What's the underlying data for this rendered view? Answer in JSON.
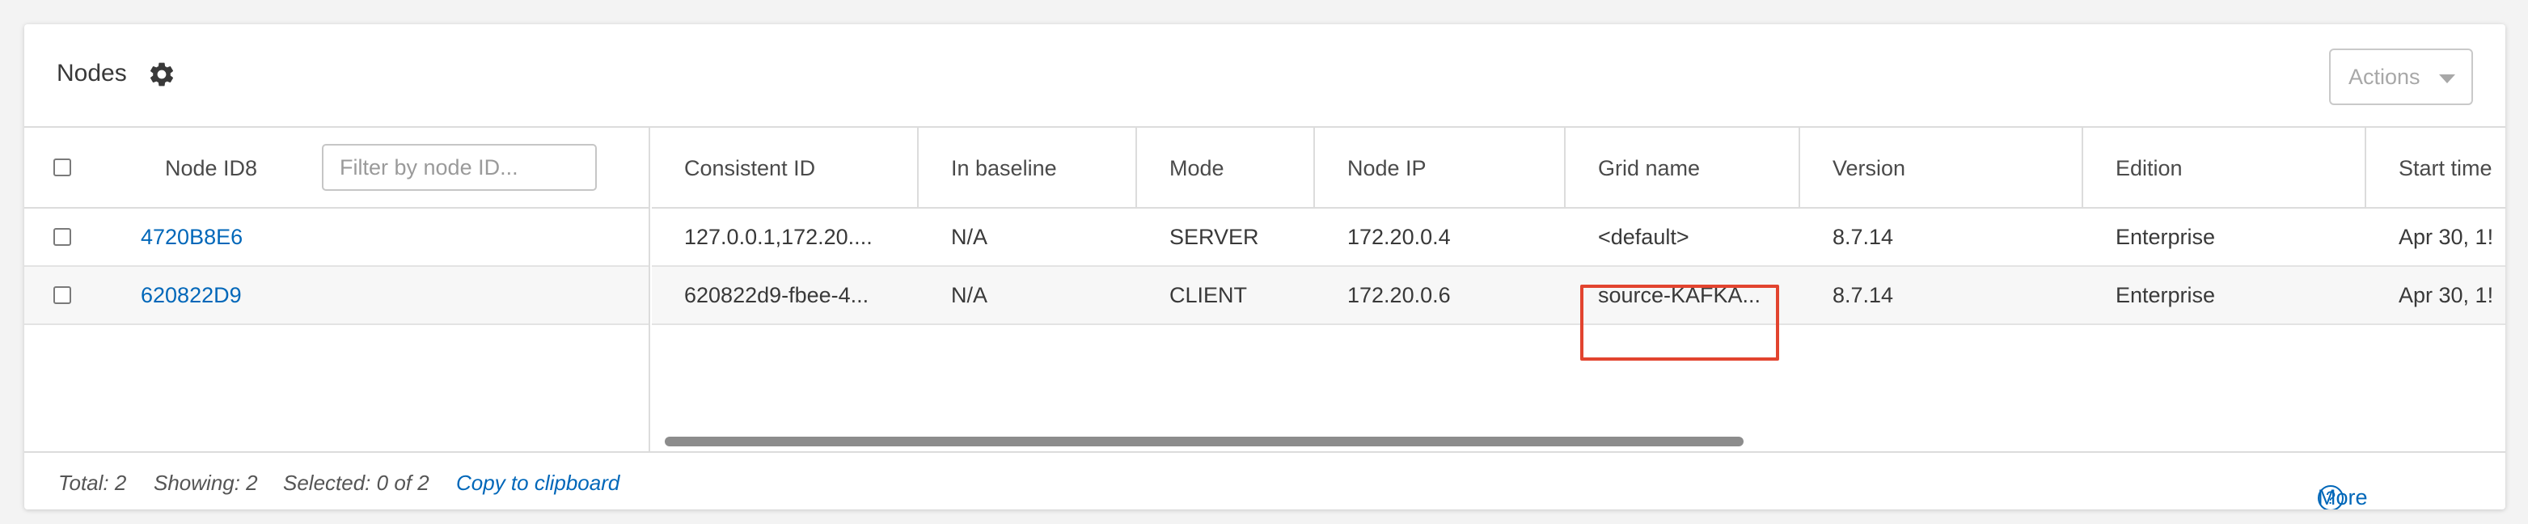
{
  "header": {
    "title": "Nodes",
    "actions_label": "Actions"
  },
  "filter": {
    "placeholder": "Filter by node ID..."
  },
  "columns": {
    "node_id8": "Node ID8",
    "consistent_id": "Consistent ID",
    "in_baseline": "In baseline",
    "mode": "Mode",
    "node_ip": "Node IP",
    "grid_name": "Grid name",
    "version": "Version",
    "edition": "Edition",
    "start_time": "Start time"
  },
  "rows": [
    {
      "node_id8": "4720B8E6",
      "consistent_id": "127.0.0.1,172.20....",
      "in_baseline": "N/A",
      "mode": "SERVER",
      "node_ip": "172.20.0.4",
      "grid_name": "<default>",
      "version": "8.7.14",
      "edition": "Enterprise",
      "start_time": "Apr 30, 1!"
    },
    {
      "node_id8": "620822D9",
      "consistent_id": "620822d9-fbee-4...",
      "in_baseline": "N/A",
      "mode": "CLIENT",
      "node_ip": "172.20.0.6",
      "grid_name": "source-KAFKA...",
      "version": "8.7.14",
      "edition": "Enterprise",
      "start_time": "Apr 30, 1!"
    }
  ],
  "footer": {
    "total": "Total: 2",
    "showing": "Showing: 2",
    "selected": "Selected: 0 of 2",
    "copy": "Copy to clipboard",
    "more_info": "More info"
  },
  "colors": {
    "link": "#0067b9",
    "highlight": "#e2442f"
  }
}
